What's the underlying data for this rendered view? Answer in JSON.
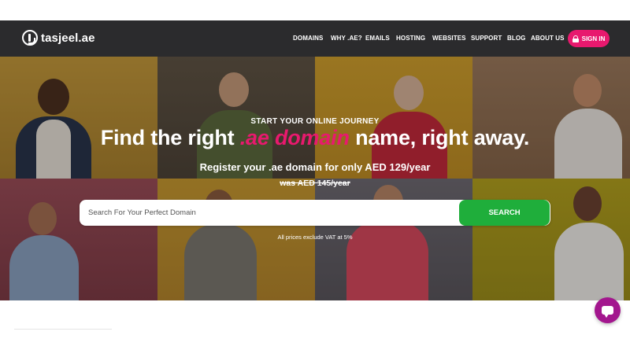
{
  "brand": {
    "name": "tasjeel.ae",
    "accent": "#e8196e",
    "nav_bg": "#2b2b2d",
    "search_green": "#1fae3b",
    "chat_color": "#a3168e"
  },
  "nav": {
    "items": [
      "DOMAINS",
      "WHY .AE?",
      "EMAILS",
      "HOSTING",
      "WEBSITES",
      "SUPPORT",
      "BLOG",
      "ABOUT US"
    ],
    "signin_label": "SIGN IN",
    "signin_icon": "lock-icon"
  },
  "hero": {
    "eyebrow": "START YOUR ONLINE JOURNEY",
    "headline_before": "Find the right ",
    "headline_accent": ".ae domain",
    "headline_after": " name, right away.",
    "subline": "Register your .ae domain for only AED 129/year",
    "old_price": "was AED 145/year",
    "search_placeholder": "Search For Your Perfect Domain",
    "search_button": "SEARCH",
    "vat_note": "All prices exclude VAT at 5%"
  },
  "chat": {
    "icon": "chat-bubble-icon"
  }
}
